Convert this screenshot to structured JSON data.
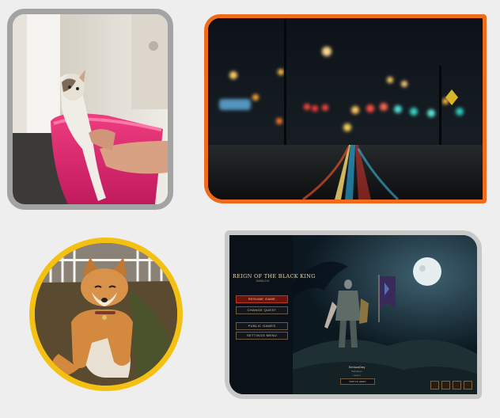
{
  "gallery": {
    "images": [
      {
        "subject": "wet cat in pink bathtub",
        "frame_color": "#a3a3a3"
      },
      {
        "subject": "night city street with bokeh lights",
        "frame_color": "#ee6a1d"
      },
      {
        "subject": "shiba inu dog sitting",
        "frame_color": "#f4c011"
      },
      {
        "subject": "game character select screen",
        "frame_color": "#c8c8c8"
      }
    ]
  },
  "game": {
    "title": "REIGN OF THE BLACK KING",
    "subtitle": "DIABLO III",
    "menu": [
      {
        "label": "RESUME GAME",
        "primary": true
      },
      {
        "label": "CHANGE QUEST",
        "primary": false
      },
      {
        "label": "PUBLIC GAMES",
        "primary": false
      },
      {
        "label": "SETTINGS MENU",
        "primary": false
      }
    ],
    "hero_name": "SeriousDay",
    "hero_class": "Barbarian",
    "hero_level": "Level 1",
    "switch_hero": "SWITCH HERO"
  }
}
